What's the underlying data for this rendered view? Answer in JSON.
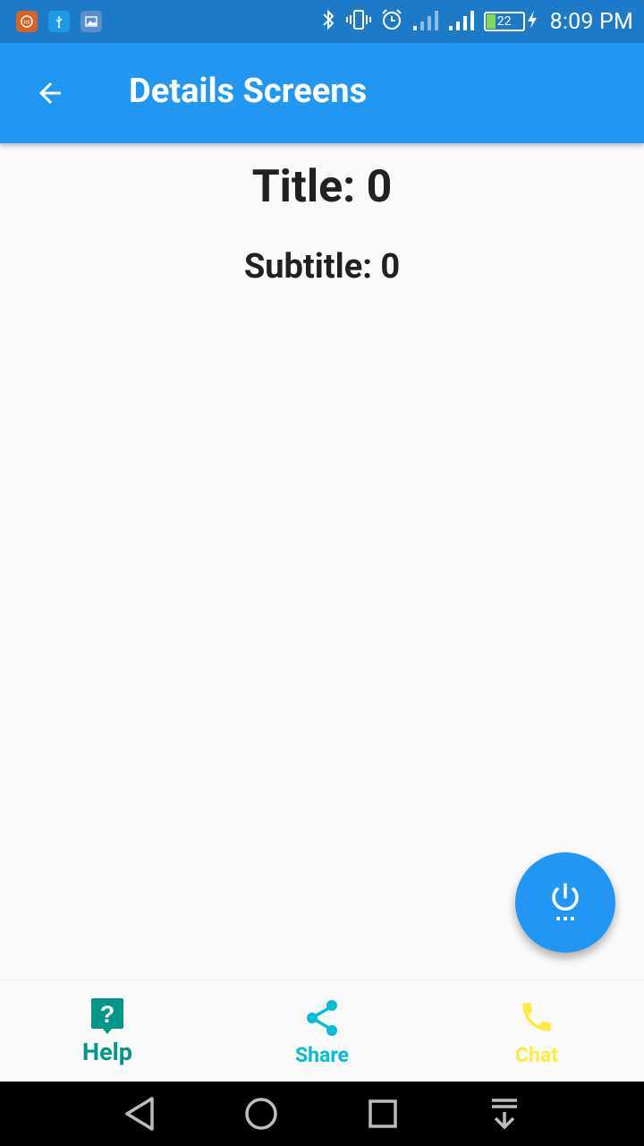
{
  "status_bar": {
    "time": "8:09 PM",
    "battery_level": "22",
    "left_icons": [
      "mi-app-icon",
      "usb-icon",
      "gallery-icon"
    ],
    "right_icons": [
      "bluetooth-icon",
      "vibrate-icon",
      "alarm-icon",
      "signal-icon",
      "signal-icon",
      "battery-icon",
      "charging-icon"
    ]
  },
  "app_bar": {
    "title": "Details Screens",
    "back_icon": "arrow-back-icon",
    "color": "#2196f3"
  },
  "content": {
    "title": "Title: 0",
    "subtitle": "Subtitle: 0"
  },
  "fab": {
    "icon": "power-settings-icon",
    "color": "#2196f3"
  },
  "bottom_nav": {
    "items": [
      {
        "label": "Help",
        "icon": "help-icon",
        "color": "#009688"
      },
      {
        "label": "Share",
        "icon": "share-icon",
        "color": "#00bcd4"
      },
      {
        "label": "Chat",
        "icon": "phone-icon",
        "color": "#ffeb3b"
      }
    ]
  },
  "system_nav": {
    "buttons": [
      "back-triangle-icon",
      "home-circle-icon",
      "recents-square-icon",
      "notification-pull-icon"
    ]
  }
}
